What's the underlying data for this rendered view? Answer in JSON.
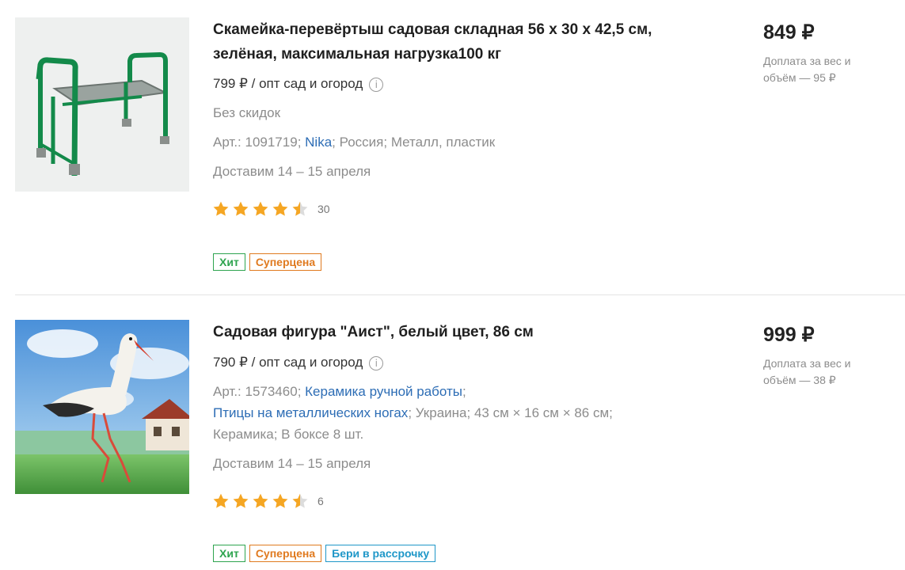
{
  "products": [
    {
      "title": "Скамейка-перевёртыш садовая складная 56 х 30 х 42,5 см, зелёная, максимальная нагрузка100 кг",
      "opt_price": "799 ₽ / опт сад и огород",
      "no_discount": "Без скидок",
      "article": "Арт.: 1091719",
      "brand": "Nika",
      "country": "Россия",
      "material": "Металл, пластик",
      "delivery": "Доставим 14 – 15 апреля",
      "rating": 4.5,
      "reviews": "30",
      "badges": {
        "hit": "Хит",
        "super": "Суперцена"
      },
      "price": "849 ₽",
      "surcharge": "Доплата за вес и объём — 95 ₽"
    },
    {
      "title": "Садовая фигура \"Аист\", белый цвет, 86 см",
      "opt_price": "790 ₽ / опт сад и огород",
      "article": "Арт.: 1573460",
      "category1": "Керамика ручной работы",
      "category2": "Птицы на металлических ногах",
      "country": "Украина",
      "size": "43 см × 16 см × 86 см",
      "material": "Керамика",
      "box": "В боксе 8 шт.",
      "delivery": "Доставим 14 – 15 апреля",
      "rating": 4.5,
      "reviews": "6",
      "badges": {
        "hit": "Хит",
        "super": "Суперцена",
        "installment": "Бери в рассрочку"
      },
      "price": "999 ₽",
      "surcharge": "Доплата за вес и объём — 38 ₽"
    }
  ],
  "colors": {
    "star": "#f5a623",
    "link": "#2d6db5",
    "hit": "#2ea44f",
    "super": "#e07a1f",
    "installment": "#1f97c8"
  }
}
